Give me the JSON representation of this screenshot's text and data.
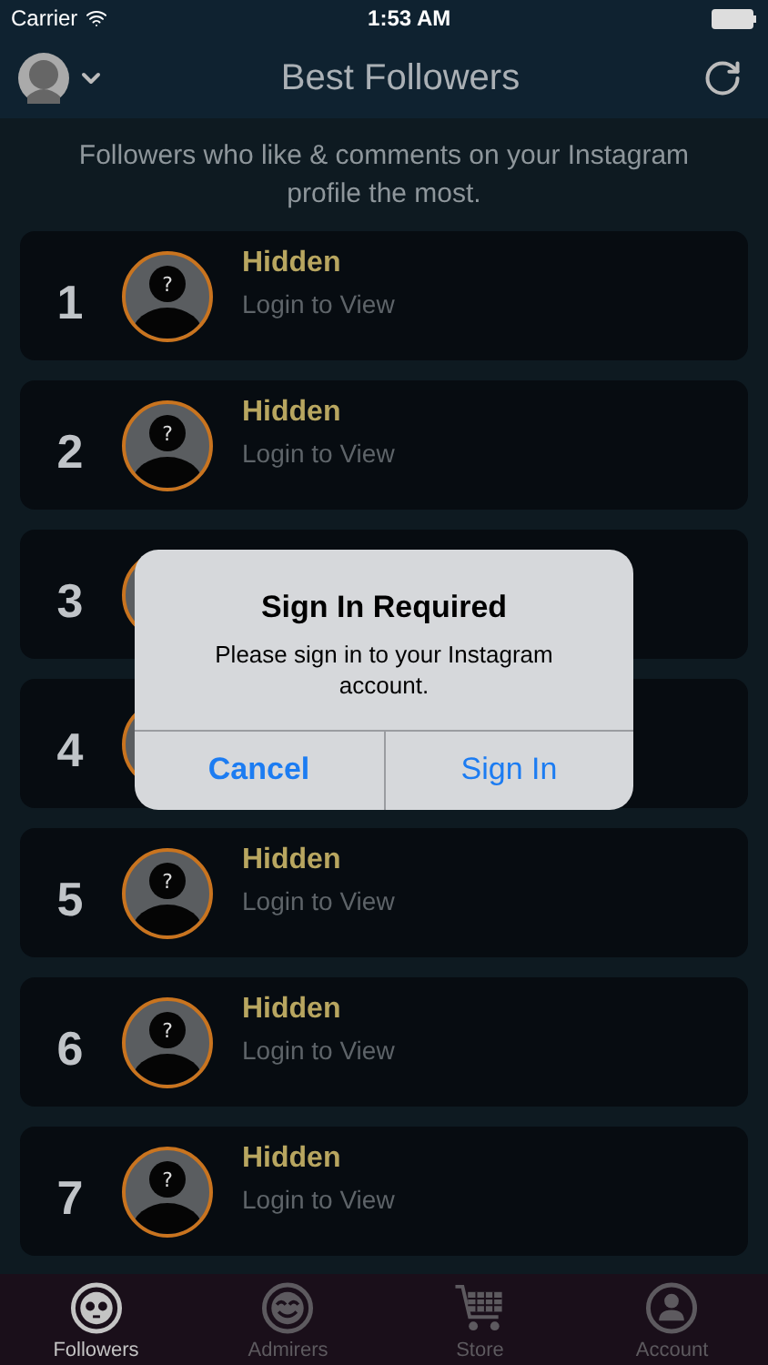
{
  "status_bar": {
    "carrier": "Carrier",
    "time": "1:53 AM"
  },
  "nav": {
    "title": "Best Followers"
  },
  "intro": "Followers who like & comments on your Instagram profile the most.",
  "rows": [
    {
      "rank": "1",
      "avatar_mark": "?",
      "name": "Hidden",
      "subtitle": "Login to View"
    },
    {
      "rank": "2",
      "avatar_mark": "?",
      "name": "Hidden",
      "subtitle": "Login to View"
    },
    {
      "rank": "3"
    },
    {
      "rank": "4"
    },
    {
      "rank": "5",
      "avatar_mark": "?",
      "name": "Hidden",
      "subtitle": "Login to View"
    },
    {
      "rank": "6",
      "avatar_mark": "?",
      "name": "Hidden",
      "subtitle": "Login to View"
    },
    {
      "rank": "7",
      "avatar_mark": "?",
      "name": "Hidden",
      "subtitle": "Login to View"
    }
  ],
  "dialog": {
    "title": "Sign In Required",
    "message": "Please sign in to your Instagram account.",
    "buttons": [
      {
        "label": "Cancel",
        "kind": "cancel"
      },
      {
        "label": "Sign In",
        "kind": "default"
      }
    ]
  },
  "tabs": [
    {
      "label": "Followers",
      "selected": true,
      "kind": "followers"
    },
    {
      "label": "Admirers",
      "selected": false,
      "kind": "admirers"
    },
    {
      "label": "Store",
      "selected": false,
      "kind": "store"
    },
    {
      "label": "Account",
      "selected": false,
      "kind": "account"
    }
  ]
}
